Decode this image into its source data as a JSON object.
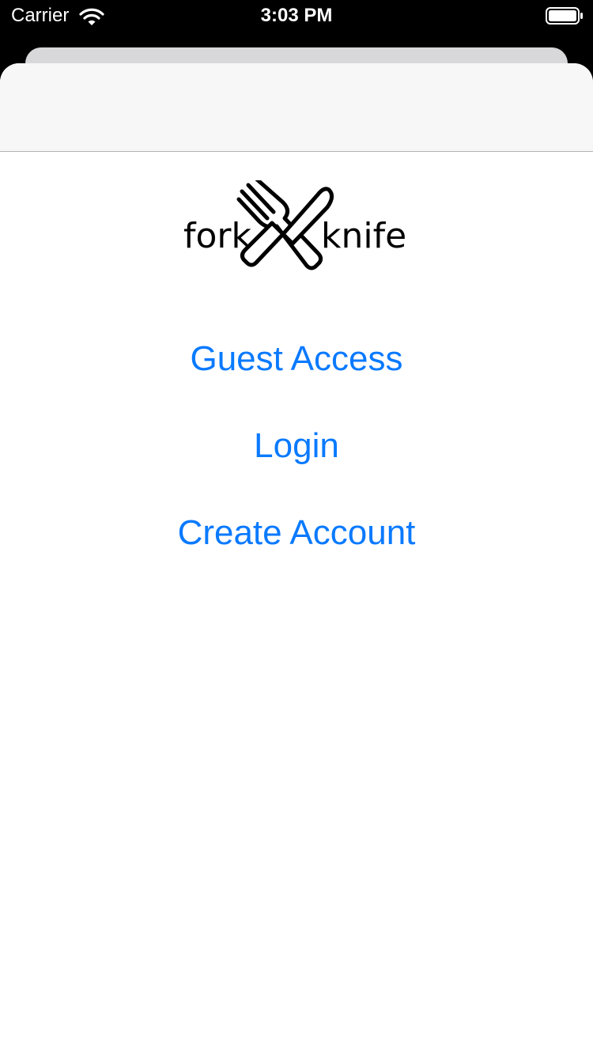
{
  "status_bar": {
    "carrier": "Carrier",
    "time": "3:03 PM",
    "icons": [
      "wifi-icon",
      "battery-icon"
    ]
  },
  "logo": {
    "text_left": "fork",
    "text_right": "knife",
    "icon": "crossed-fork-knife-icon"
  },
  "menu": {
    "guest_label": "Guest Access",
    "login_label": "Login",
    "create_label": "Create Account"
  },
  "colors": {
    "accent": "#0a7aff",
    "nav_background": "#f7f7f8",
    "sheet_background": "#ffffff",
    "status_background": "#000000"
  }
}
